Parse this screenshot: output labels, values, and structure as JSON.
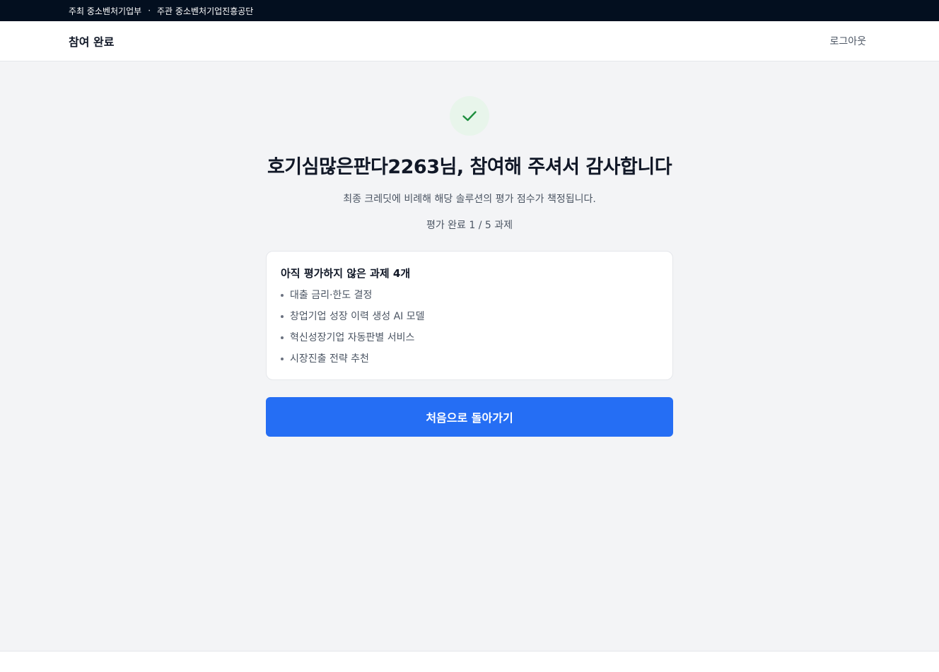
{
  "topbar": {
    "host": "주최 중소벤처기업부",
    "separator": "·",
    "organizer": "주관 중소벤처기업진흥공단"
  },
  "header": {
    "title": "참여 완료",
    "logout_label": "로그아웃"
  },
  "main": {
    "icon": "check-icon",
    "headline": "호기심많은판다2263님, 참여해 주셔서 감사합니다",
    "subtitle": "최종 크레딧에 비례해 해당 솔루션의 평가 점수가 책정됩니다.",
    "progress": "평가 완료 1 / 5 과제",
    "pending_card": {
      "title": "아직 평가하지 않은 과제 4개",
      "items": [
        "대출 금리·한도 결정",
        "창업기업 성장 이력 생성 AI 모델",
        "혁신성장기업 자동판별 서비스",
        "시장진출 전략 추천"
      ]
    },
    "back_button_label": "처음으로 돌아가기"
  },
  "colors": {
    "topbar_bg": "#030f1f",
    "page_bg": "#f3f4f6",
    "primary": "#256ef4",
    "success": "#1e8e3e",
    "success_bg": "#e8f5eb"
  }
}
